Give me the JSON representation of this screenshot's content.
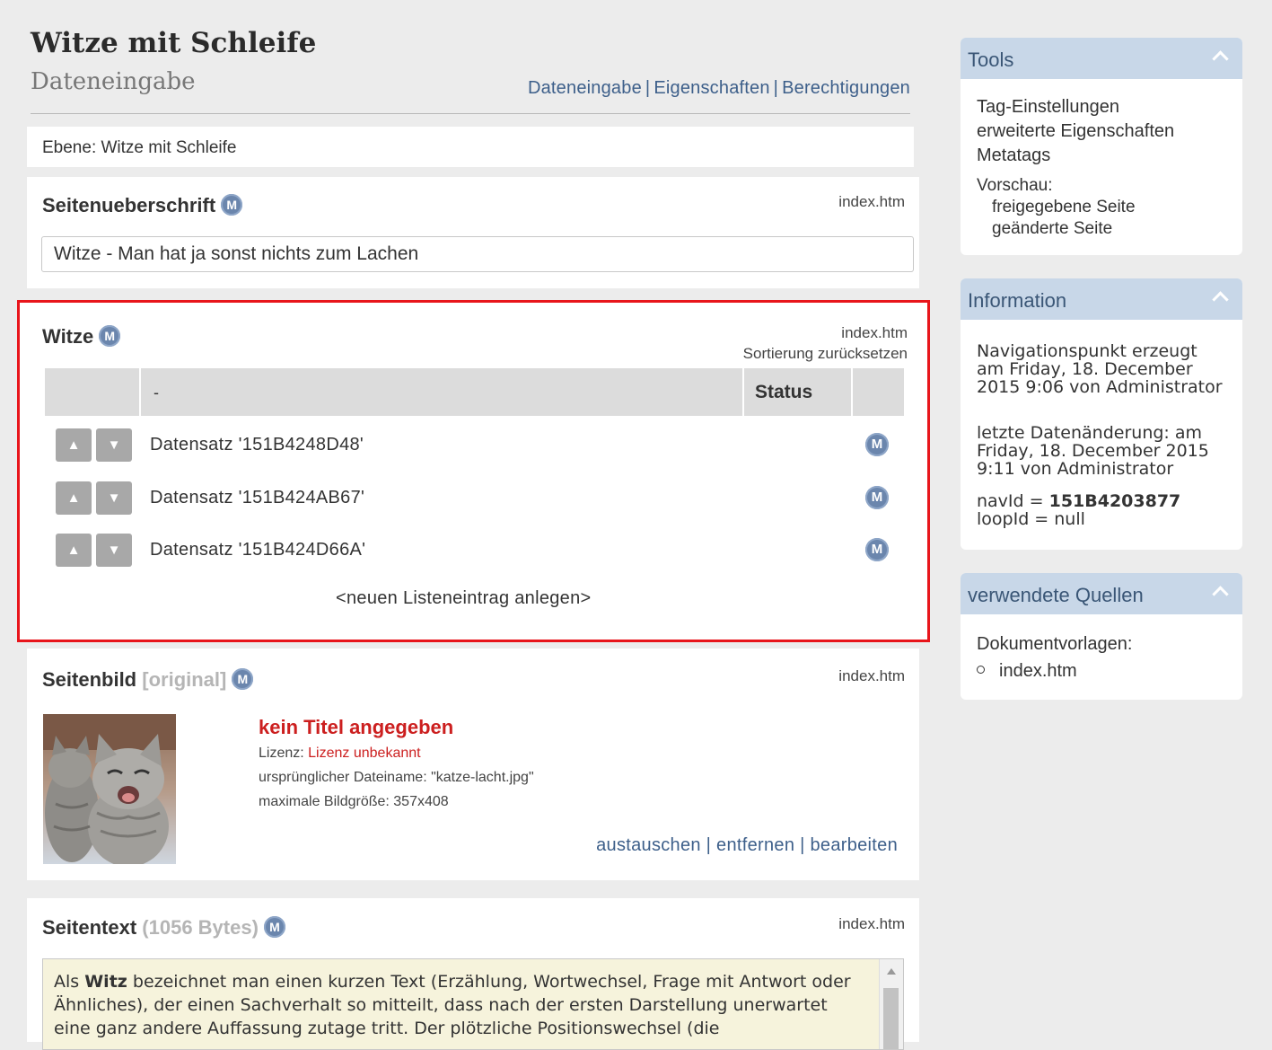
{
  "header": {
    "title": "Witze mit Schleife",
    "subtitle": "Dateneingabe",
    "nav": [
      "Dateneingabe",
      "Eigenschaften",
      "Berechtigungen"
    ]
  },
  "level": "Ebene: Witze mit Schleife",
  "seitenueberschrift": {
    "title": "Seitenueberschrift",
    "badge": "M",
    "file": "index.htm",
    "value": "Witze - Man hat ja sonst nichts zum Lachen"
  },
  "witze": {
    "title": "Witze",
    "badge": "M",
    "file": "index.htm",
    "reset_sort": "Sortierung zurücksetzen",
    "columns": [
      "-",
      "Status"
    ],
    "rows": [
      {
        "label": "Datensatz '151B4248D48'",
        "badge": "M"
      },
      {
        "label": "Datensatz '151B424AB67'",
        "badge": "M"
      },
      {
        "label": "Datensatz '151B424D66A'",
        "badge": "M"
      }
    ],
    "new_entry": "<neuen Listeneintrag anlegen>"
  },
  "seitenbild": {
    "title": "Seitenbild",
    "tag": "[original]",
    "badge": "M",
    "file": "index.htm",
    "image_title": "kein Titel angegeben",
    "license_label": "Lizenz:",
    "license_value": "Lizenz unbekannt",
    "filename": "ursprünglicher Dateiname: \"katze-lacht.jpg\"",
    "max_size": "maximale Bildgröße: 357x408",
    "actions": [
      "austauschen",
      "entfernen",
      "bearbeiten"
    ]
  },
  "seitentext": {
    "title": "Seitentext",
    "size": "(1056 Bytes)",
    "badge": "M",
    "file": "index.htm",
    "text_bold": "Witz",
    "text_pre": "Als ",
    "text_post": " bezeichnet man einen kurzen Text (Erzählung, Wortwechsel, Frage mit Antwort oder Ähnliches), der einen Sachverhalt so mitteilt, dass nach der ersten Darstellung unerwartet eine ganz andere Auffassung zutage tritt. Der plötzliche Positionswechsel (die"
  },
  "sidebar": {
    "tools": {
      "title": "Tools",
      "items": [
        "Tag-Einstellungen",
        "erweiterte Eigenschaften",
        "Metatags"
      ],
      "preview_label": "Vorschau:",
      "preview_items": [
        "freigegebene Seite",
        "geänderte Seite"
      ]
    },
    "information": {
      "title": "Information",
      "created": "Navigationspunkt erzeugt am Friday, 18. December 2015 9:06 von Administrator",
      "changed": "letzte Datenänderung: am Friday, 18. December 2015 9:11 von Administrator",
      "navid_label": "navId = ",
      "navid_value": "151B4203877",
      "loopid": "loopId = null"
    },
    "sources": {
      "title": "verwendete Quellen",
      "label": "Dokumentvorlagen:",
      "items": [
        "index.htm"
      ]
    }
  },
  "colors": {
    "link": "#3d5f8a",
    "highlight_border": "#e8151b",
    "sidebar_header": "#c8d7e8",
    "badge": "#6b86ad",
    "error_red": "#cc1f1f"
  }
}
